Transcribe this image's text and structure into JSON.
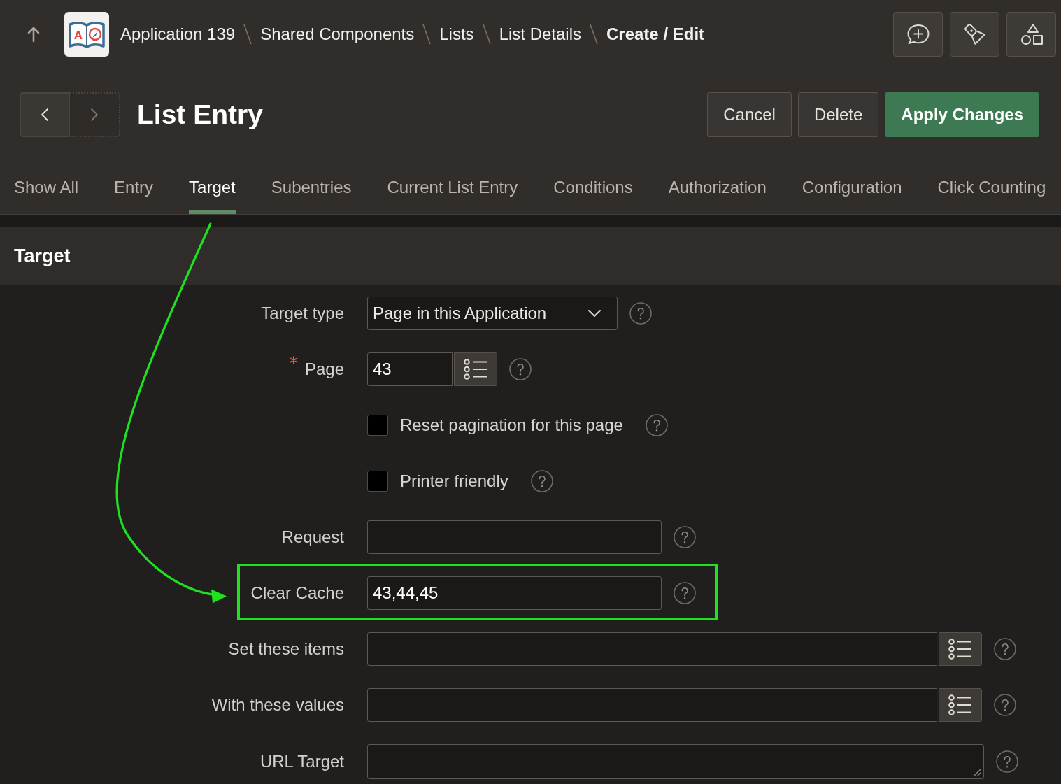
{
  "top_bar": {
    "logo": {
      "letter": "A"
    },
    "breadcrumbs": [
      {
        "label": "Application 139",
        "current": false
      },
      {
        "label": "Shared Components",
        "current": false
      },
      {
        "label": "Lists",
        "current": false
      },
      {
        "label": "List Details",
        "current": false
      },
      {
        "label": "Create / Edit",
        "current": true
      }
    ]
  },
  "header": {
    "nav_buttons": [
      {
        "kind": "previous",
        "disabled": false
      },
      {
        "kind": "next",
        "disabled": true
      }
    ],
    "title": "List Entry",
    "buttons": [
      {
        "label": "Cancel",
        "kind": "default"
      },
      {
        "label": "Delete",
        "kind": "default"
      },
      {
        "label": "Apply Changes",
        "kind": "primary"
      }
    ]
  },
  "tabs": [
    {
      "label": "Show All",
      "selected": false
    },
    {
      "label": "Entry",
      "selected": false
    },
    {
      "label": "Target",
      "selected": true
    },
    {
      "label": "Subentries",
      "selected": false
    },
    {
      "label": "Current List Entry",
      "selected": false
    },
    {
      "label": "Conditions",
      "selected": false
    },
    {
      "label": "Authorization",
      "selected": false
    },
    {
      "label": "Configuration",
      "selected": false
    },
    {
      "label": "Click Counting",
      "selected": false
    }
  ],
  "region": {
    "title": "Target"
  },
  "form": {
    "fields": [
      {
        "kind": "select",
        "label": "Target type",
        "value": "Page in this Application",
        "required": false,
        "highlighted": false
      },
      {
        "kind": "lookup",
        "label": "Page",
        "value": "43",
        "required": true,
        "highlighted": false
      },
      {
        "kind": "checkbox",
        "label": "Reset pagination for this page",
        "checked": false,
        "required": false,
        "highlighted": false
      },
      {
        "kind": "checkbox",
        "label": "Printer friendly",
        "checked": false,
        "required": false,
        "highlighted": false
      },
      {
        "kind": "text",
        "label": "Request",
        "required": false,
        "highlighted": false
      },
      {
        "kind": "text",
        "label": "Clear Cache",
        "value": "43,44,45",
        "required": false,
        "highlighted": true
      },
      {
        "kind": "popup",
        "label": "Set these items",
        "required": false,
        "highlighted": false
      },
      {
        "kind": "popup",
        "label": "With these values",
        "required": false,
        "highlighted": false
      },
      {
        "kind": "textarea",
        "label": "URL Target",
        "required": false,
        "highlighted": false
      }
    ]
  }
}
